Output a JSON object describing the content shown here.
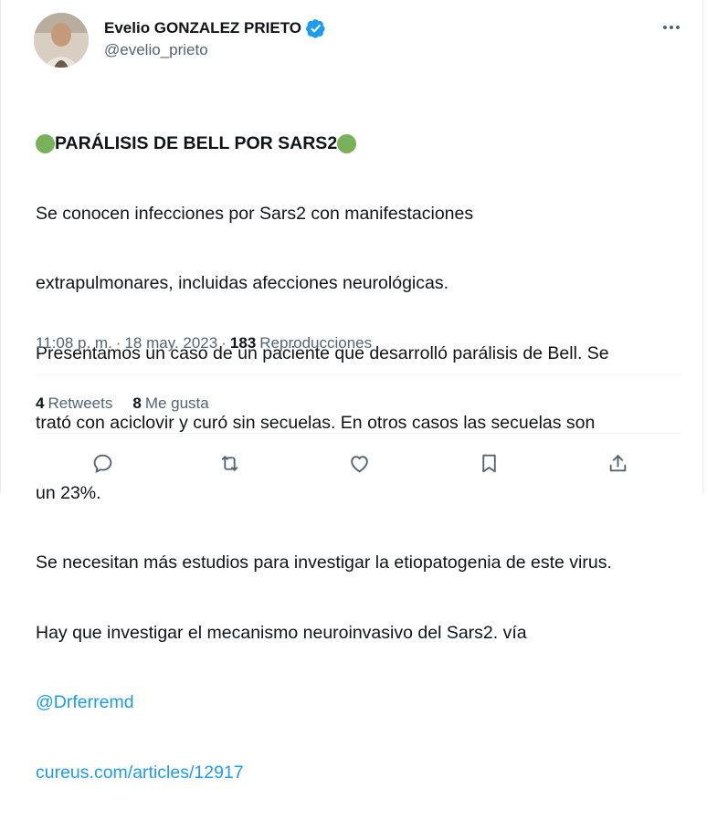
{
  "author": {
    "display_name": "Evelio GONZALEZ PRIETO",
    "handle": "@evelio_prieto",
    "verified": true
  },
  "tweet": {
    "heading": "PARÁLISIS DE BELL POR SARS2",
    "lines": [
      "Se conocen infecciones por Sars2 con manifestaciones",
      "extrapulmonares, incluidas afecciones neurológicas.",
      "Presentamos un caso de un paciente que desarrolló parálisis de Bell. Se",
      "trató con aciclovir y curó sin secuelas. En otros casos las secuelas son",
      "un 23%.",
      "Se necesitan más estudios para investigar la etiopatogenia de este virus.",
      "Hay que investigar el mecanismo neuroinvasivo del Sars2. vía"
    ],
    "mention": "@Drferremd",
    "link": "cureus.com/articles/12917"
  },
  "meta": {
    "time": "11:08 p. m.",
    "sep1": "·",
    "date": "18 may. 2023",
    "sep2": "·",
    "views_count": "183",
    "views_label": "Reproducciones"
  },
  "stats": {
    "retweets_count": "4",
    "retweets_label": "Retweets",
    "likes_count": "8",
    "likes_label": "Me gusta"
  },
  "icons": {
    "more": "more-icon",
    "reply": "reply-icon",
    "retweet": "retweet-icon",
    "like": "heart-icon",
    "bookmark": "bookmark-icon",
    "share": "share-icon"
  },
  "colors": {
    "accent": "#1d9bf0",
    "muted": "#536471",
    "green_circle": "#78b159"
  }
}
